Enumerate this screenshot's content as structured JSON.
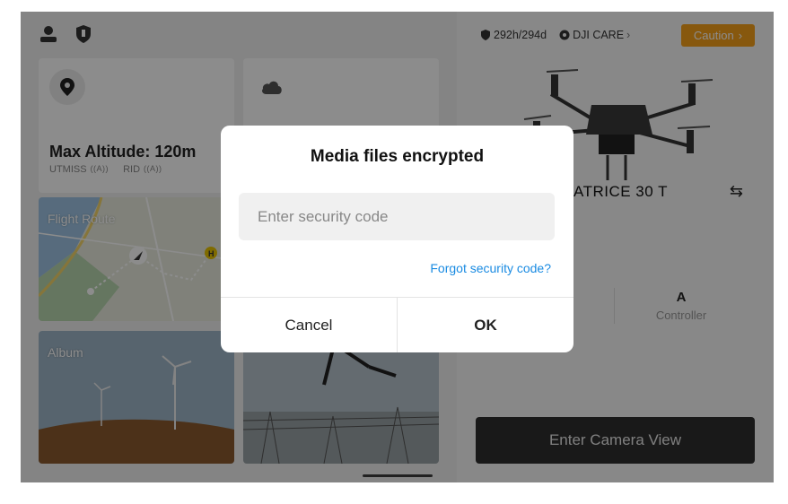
{
  "left": {
    "altitude_title": "Max Altitude: 120m",
    "altitude_sub": [
      "UTMISS",
      "RID"
    ],
    "route_label": "Flight Route",
    "album_label": "Album"
  },
  "right": {
    "flight_hours": "292h/294d",
    "dji_care": "DJI CARE",
    "caution_label": "Caution",
    "drone_name": "ATRICE 30 T",
    "stat_value": "A",
    "stat_label": "Controller",
    "camera_button": "Enter Camera View"
  },
  "dialog": {
    "title": "Media files encrypted",
    "input_placeholder": "Enter security code",
    "forgot_link": "Forgot security code?",
    "cancel": "Cancel",
    "ok": "OK"
  },
  "colors": {
    "caution": "#f6a01a",
    "link": "#1a8be2",
    "camera_button": "#2f2f2f"
  },
  "icons": [
    "user-icon",
    "shield-icon",
    "location-pin-icon",
    "cloud-icon",
    "aircraft-arrow-icon",
    "heliport-icon",
    "hours-shield-icon",
    "care-icon",
    "chevron-right-icon",
    "swap-icon"
  ]
}
